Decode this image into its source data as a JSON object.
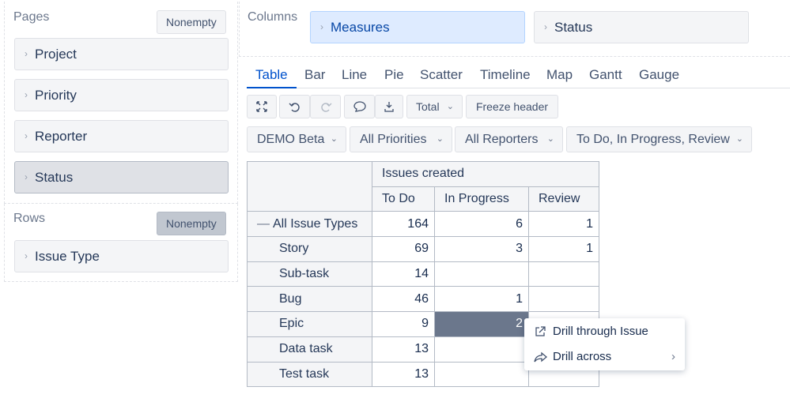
{
  "pages": {
    "title": "Pages",
    "nonempty_label": "Nonempty",
    "items": [
      {
        "label": "Project"
      },
      {
        "label": "Priority"
      },
      {
        "label": "Reporter"
      },
      {
        "label": "Status"
      }
    ]
  },
  "rows": {
    "title": "Rows",
    "nonempty_label": "Nonempty",
    "items": [
      {
        "label": "Issue Type"
      }
    ]
  },
  "columns": {
    "title": "Columns",
    "items": [
      {
        "label": "Measures"
      },
      {
        "label": "Status"
      }
    ]
  },
  "tabs": [
    "Table",
    "Bar",
    "Line",
    "Pie",
    "Scatter",
    "Timeline",
    "Map",
    "Gantt",
    "Gauge"
  ],
  "toolbar": {
    "total_label": "Total",
    "freeze_label": "Freeze header"
  },
  "filters": [
    "DEMO Beta",
    "All Priorities",
    "All Reporters",
    "To Do, In Progress, Review"
  ],
  "table": {
    "measure_header": "Issues created",
    "columns": [
      "To Do",
      "In Progress",
      "Review"
    ],
    "rows": [
      {
        "label": "All Issue Types",
        "values": [
          "164",
          "6",
          "1"
        ]
      },
      {
        "label": "Story",
        "values": [
          "69",
          "3",
          "1"
        ]
      },
      {
        "label": "Sub-task",
        "values": [
          "14",
          "",
          ""
        ]
      },
      {
        "label": "Bug",
        "values": [
          "46",
          "1",
          ""
        ]
      },
      {
        "label": "Epic",
        "values": [
          "9",
          "2",
          ""
        ]
      },
      {
        "label": "Data task",
        "values": [
          "13",
          "",
          ""
        ]
      },
      {
        "label": "Test task",
        "values": [
          "13",
          "",
          ""
        ]
      }
    ]
  },
  "context_menu": {
    "drill_through": "Drill through Issue",
    "drill_across": "Drill across"
  },
  "colors": {
    "accent": "#0052cc",
    "selected_cell": "#6b778c",
    "measures_bg": "#deebff"
  }
}
